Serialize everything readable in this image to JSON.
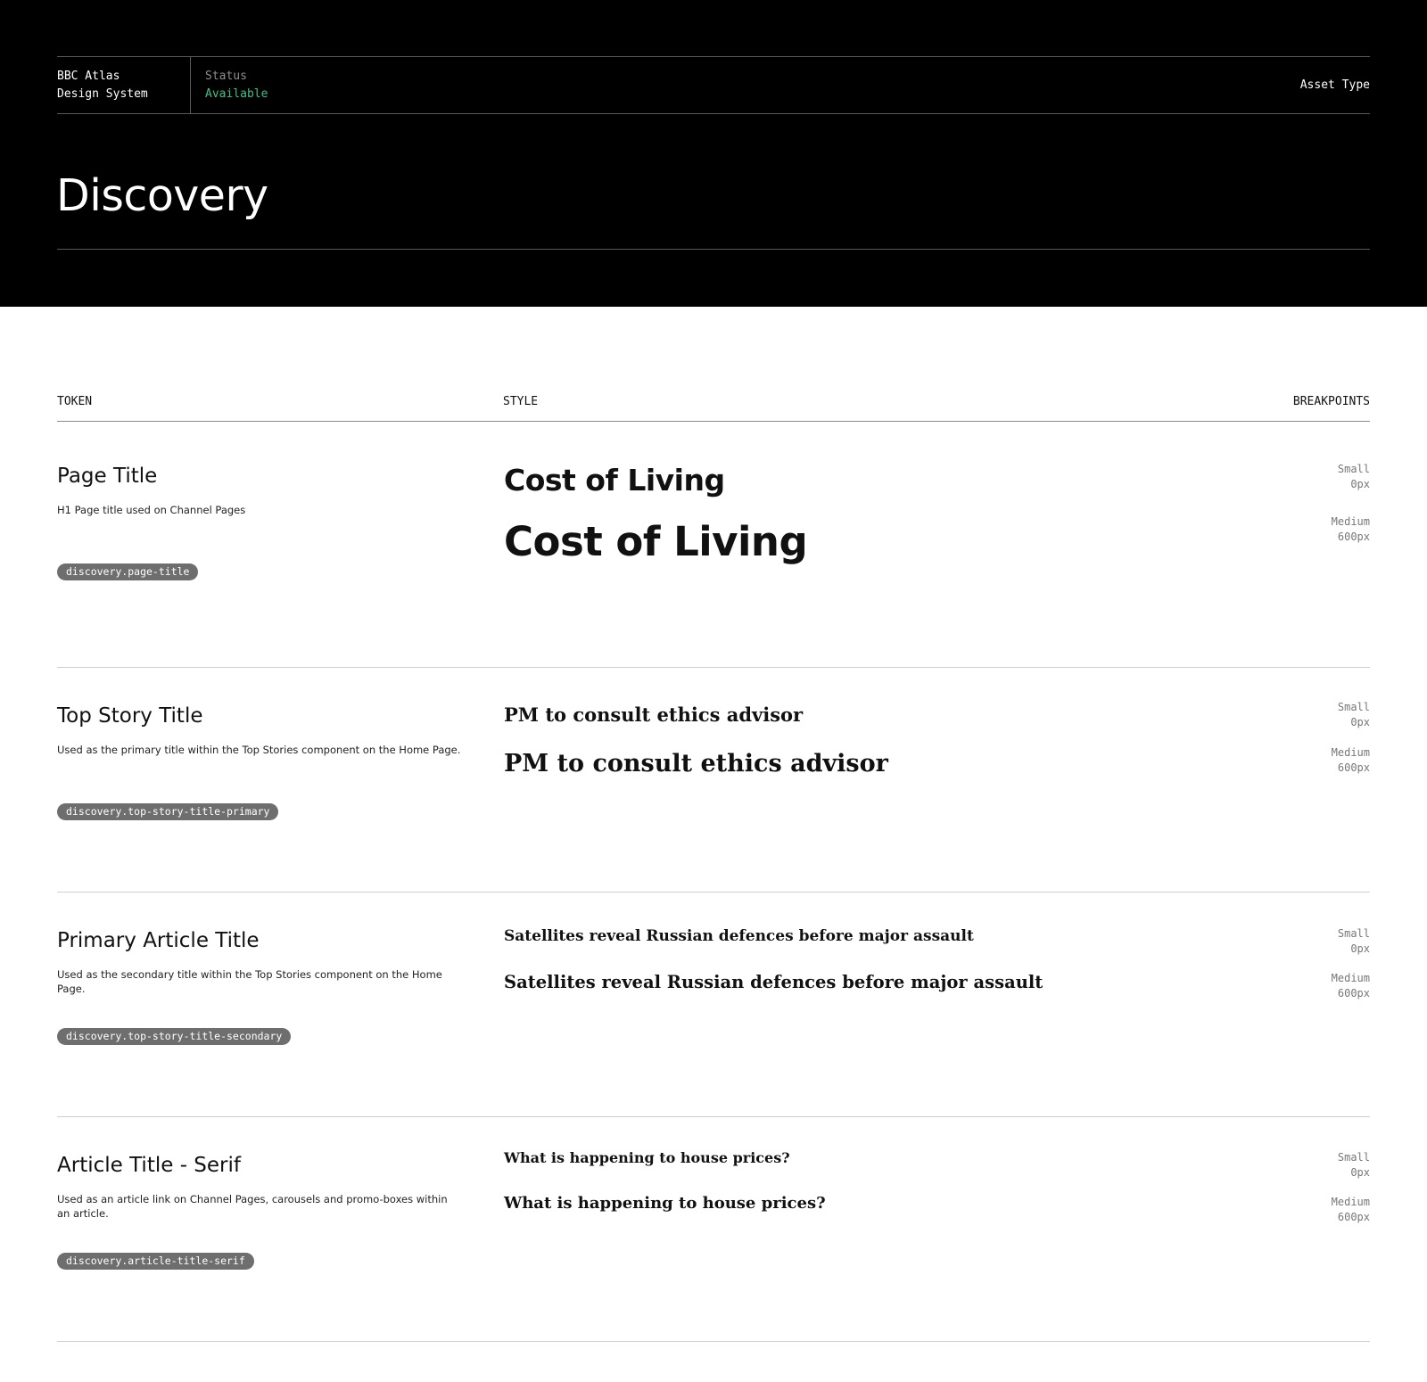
{
  "header": {
    "brand_line1": "BBC Atlas",
    "brand_line2": "Design System",
    "status_label": "Status",
    "status_value": "Available",
    "asset_type": "Asset Type",
    "title": "Discovery"
  },
  "columns": {
    "token": "TOKEN",
    "style": "STYLE",
    "breakpoints": "BREAKPOINTS"
  },
  "tokens": [
    {
      "name": "Page Title",
      "description": "H1 Page title used on Channel Pages",
      "token": "discovery.page-title",
      "sample_small": "Cost of Living",
      "sample_medium": "Cost of Living",
      "bp_small_label": "Small",
      "bp_small_value": "0px",
      "bp_medium_label": "Medium",
      "bp_medium_value": "600px"
    },
    {
      "name": "Top Story Title",
      "description": "Used as the primary title within the Top Stories component on the Home Page.",
      "token": "discovery.top-story-title-primary",
      "sample_small": "PM to consult ethics advisor",
      "sample_medium": "PM to consult ethics advisor",
      "bp_small_label": "Small",
      "bp_small_value": "0px",
      "bp_medium_label": "Medium",
      "bp_medium_value": "600px"
    },
    {
      "name": "Primary Article Title",
      "description": "Used as the secondary title within the Top Stories component on the Home Page.",
      "token": "discovery.top-story-title-secondary",
      "sample_small": "Satellites reveal Russian defences before major assault",
      "sample_medium": "Satellites reveal Russian defences before major assault",
      "bp_small_label": "Small",
      "bp_small_value": "0px",
      "bp_medium_label": "Medium",
      "bp_medium_value": "600px"
    },
    {
      "name": "Article Title - Serif",
      "description": "Used as an article link on Channel Pages, carousels and promo-boxes within an article.",
      "token": "discovery.article-title-serif",
      "sample_small": "What is happening to house prices?",
      "sample_medium": "What is happening to house prices?",
      "bp_small_label": "Small",
      "bp_small_value": "0px",
      "bp_medium_label": "Medium",
      "bp_medium_value": "600px"
    }
  ],
  "colors": {
    "hero_background": "#000000",
    "status_available": "#3ec08a",
    "pill_background": "#6e6e6e"
  }
}
